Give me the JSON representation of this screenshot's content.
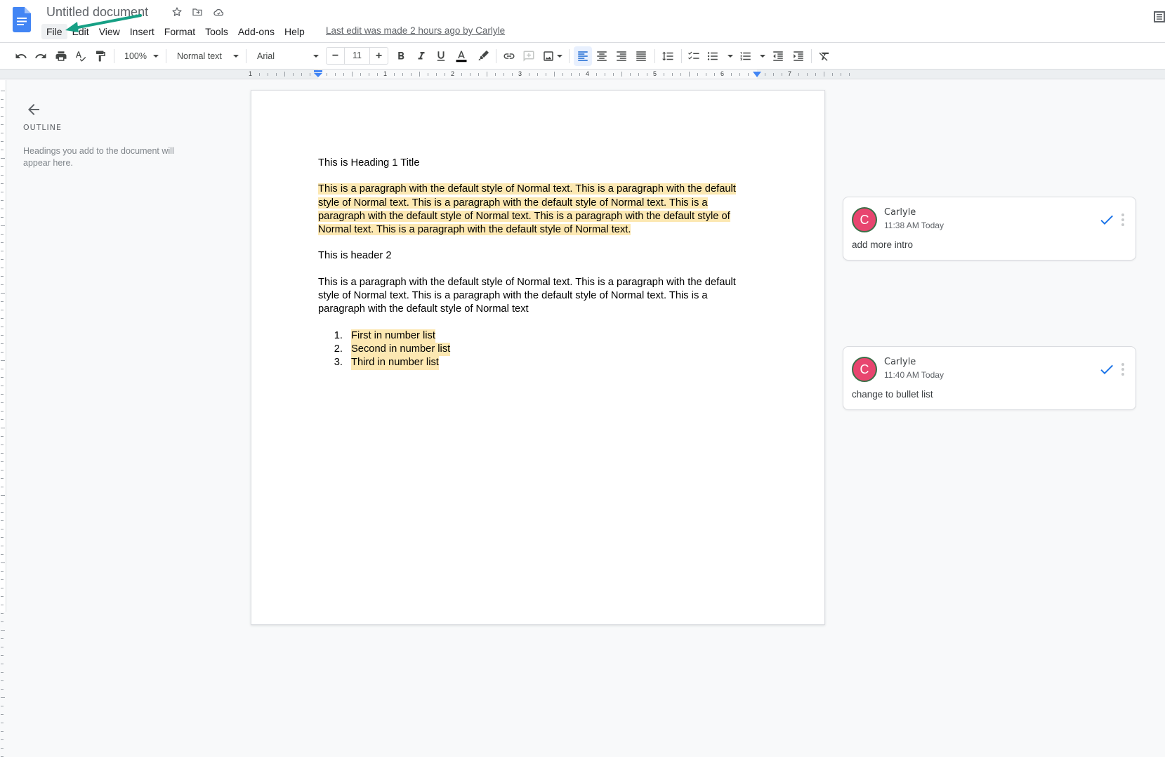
{
  "titlebar": {
    "doc_title": "Untitled document",
    "last_edit": "Last edit was made 2 hours ago by Carlyle",
    "icons": [
      "star-icon",
      "move-to-folder-icon",
      "cloud-saved-icon"
    ]
  },
  "menu": {
    "items": [
      {
        "label": "File",
        "active": true
      },
      {
        "label": "Edit"
      },
      {
        "label": "View"
      },
      {
        "label": "Insert"
      },
      {
        "label": "Format"
      },
      {
        "label": "Tools"
      },
      {
        "label": "Add-ons"
      },
      {
        "label": "Help"
      }
    ]
  },
  "toolbar": {
    "zoom": "100%",
    "style": "Normal text",
    "font": "Arial",
    "font_size": "11",
    "minus": "−",
    "plus": "+",
    "text_color": "#000000"
  },
  "ruler": {
    "labels": [
      "1",
      "1",
      "2",
      "3",
      "4",
      "5",
      "6",
      "7"
    ]
  },
  "outline": {
    "title": "OUTLINE",
    "hint": "Headings you add to the document will appear here."
  },
  "document": {
    "heading1": "This is Heading 1 Title",
    "para1": "This is a paragraph with the default style of Normal text. This is a paragraph with the default style of Normal text. This is a paragraph with the default style of Normal text. This is a paragraph with the default style of Normal text. This is a paragraph with the default style of Normal text. This is a paragraph with the default style of Normal text.",
    "heading2": "This is header 2",
    "para2": "This is a paragraph with the default style of Normal text. This is a paragraph with the default style of Normal text. This is a paragraph with the default style of Normal text. This is a paragraph with the default style of Normal text",
    "list": [
      {
        "num": "1.",
        "text": "First in number list"
      },
      {
        "num": "2.",
        "text": "Second in number list"
      },
      {
        "num": "3.",
        "text": "Third in number list"
      }
    ],
    "highlight_color": "#fce8b2"
  },
  "comments": [
    {
      "initial": "C",
      "author": "Carlyle",
      "time": "11:38 AM Today",
      "text": "add more intro"
    },
    {
      "initial": "C",
      "author": "Carlyle",
      "time": "11:40 AM Today",
      "text": "change to bullet list"
    }
  ],
  "colors": {
    "accent": "#1a73e8",
    "avatar": "#e8456f",
    "annotation_arrow": "#17a085"
  }
}
